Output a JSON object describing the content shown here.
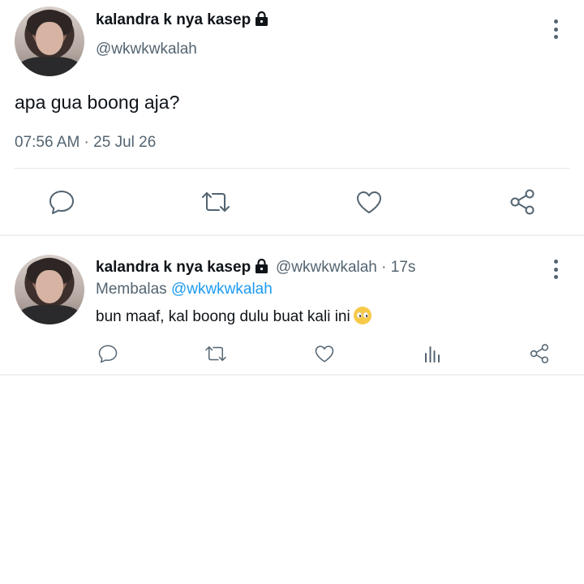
{
  "main_tweet": {
    "display_name": "kalandra k nya kasep",
    "handle": "@wkwkwkalah",
    "text": "apa gua boong aja?",
    "timestamp": "07:56 AM · 25 Jul 26",
    "protected": true
  },
  "reply_tweet": {
    "display_name": "kalandra k nya kasep",
    "handle_time": "@wkwkwkalah · 17s",
    "replying_label": "Membalas",
    "replying_to": "@wkwkwkalah",
    "text": "bun maaf, kal boong dulu buat kali ini",
    "emoji": "pleading-face",
    "protected": true
  },
  "icons": {
    "reply": "reply-icon",
    "retweet": "retweet-icon",
    "like": "like-icon",
    "analytics": "analytics-icon",
    "share": "share-icon",
    "more": "more-icon",
    "lock": "lock-icon"
  },
  "colors": {
    "text": "#0f1419",
    "secondary": "#536471",
    "link": "#1d9bf0",
    "divider": "#e6e9ec"
  }
}
